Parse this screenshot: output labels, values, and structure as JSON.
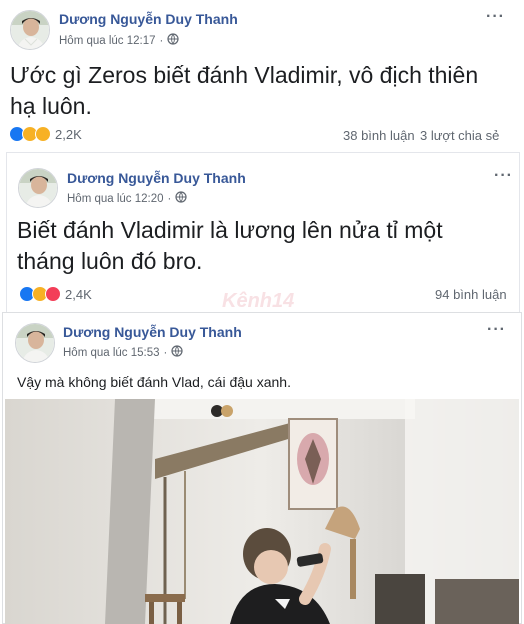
{
  "posts": [
    {
      "author": "Dương Nguyễn Duy Thanh",
      "time": "Hôm qua lúc 12:17",
      "content": "Ước gì Zeros biết đánh Vladimir, vô địch thiên hạ luôn.",
      "reaction_count": "2,2K",
      "comments": "38 bình luận",
      "shares": "3 lượt chia sẻ",
      "reactions": [
        "like-icon",
        "haha-icon",
        "sad-icon"
      ]
    },
    {
      "author": "Dương Nguyễn Duy Thanh",
      "time": "Hôm qua lúc 12:20",
      "content": "Biết đánh Vladimir là lương lên nửa tỉ một tháng luôn đó bro.",
      "reaction_count": "2,4K",
      "comments": "94 bình luận",
      "reactions": [
        "like-icon",
        "haha-icon",
        "love-icon"
      ]
    },
    {
      "author": "Dương Nguyễn Duy Thanh",
      "time": "Hôm qua lúc 15:53",
      "content": "Vậy mà không biết đánh Vlad, cái đậu xanh."
    }
  ],
  "more_icon": "···",
  "colors": {
    "author": "#385898",
    "meta": "#606770",
    "like": "#1877f2",
    "haha": "#f7b125",
    "love": "#f33e58"
  }
}
